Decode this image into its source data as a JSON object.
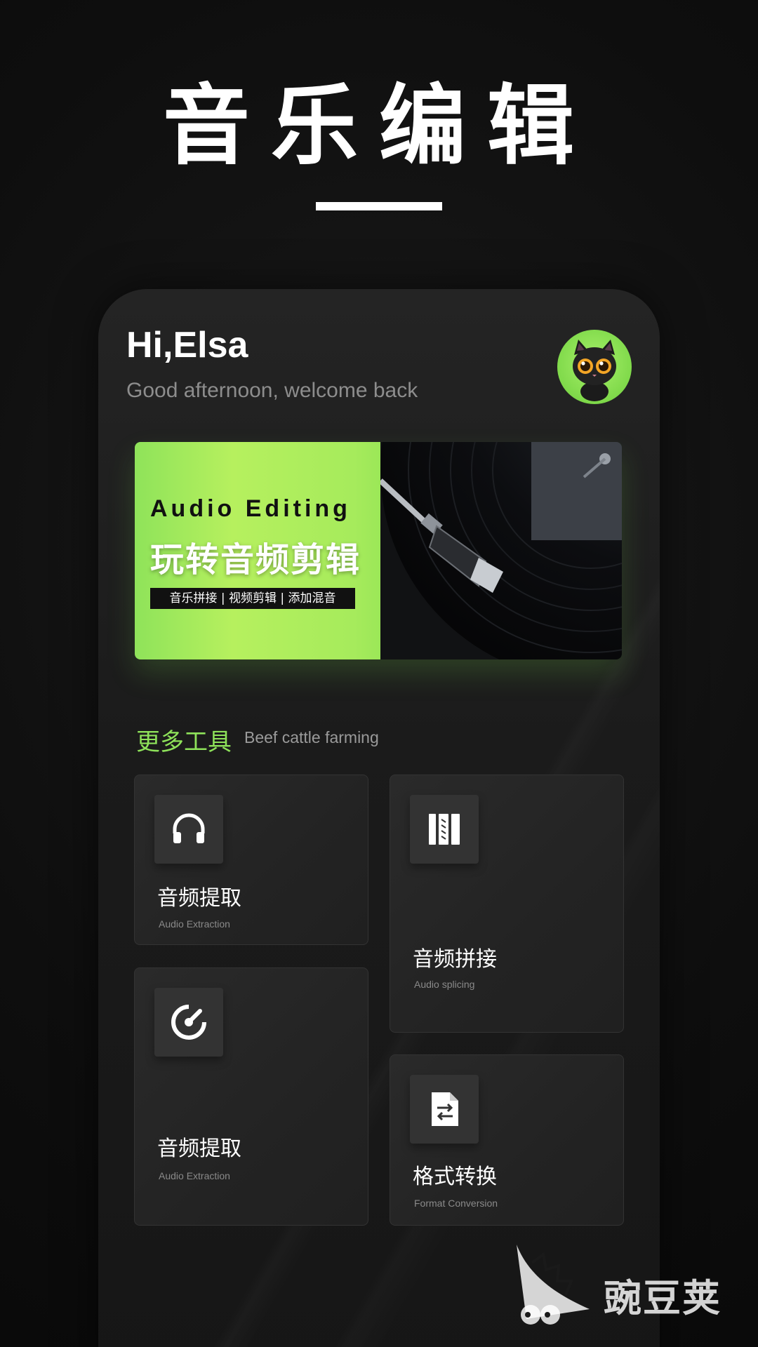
{
  "hero": {
    "title": "音乐编辑"
  },
  "header": {
    "greeting": "Hi,Elsa",
    "subtitle": "Good afternoon, welcome back",
    "avatar_icon": "cat-avatar-icon"
  },
  "banner": {
    "title_en": "Audio Editing",
    "title_cn": "玩转音频剪辑",
    "tags": "音乐拼接 | 视频剪辑 | 添加混音",
    "image_icon": "vinyl-turntable"
  },
  "tools": {
    "title": "更多工具",
    "subtitle": "Beef cattle farming",
    "items": [
      {
        "title": "音频提取",
        "subtitle": "Audio Extraction",
        "icon": "headphones-icon"
      },
      {
        "title": "音频拼接",
        "subtitle": "Audio splicing",
        "icon": "book-icon"
      },
      {
        "title": "音频提取",
        "subtitle": "Audio Extraction",
        "icon": "gauge-icon"
      },
      {
        "title": "格式转换",
        "subtitle": "Format Conversion",
        "icon": "file-convert-icon"
      }
    ]
  },
  "watermark": {
    "text": "豌豆荚"
  },
  "colors": {
    "accent": "#8ee25a",
    "background": "#0c0c0c",
    "card": "#262626"
  }
}
